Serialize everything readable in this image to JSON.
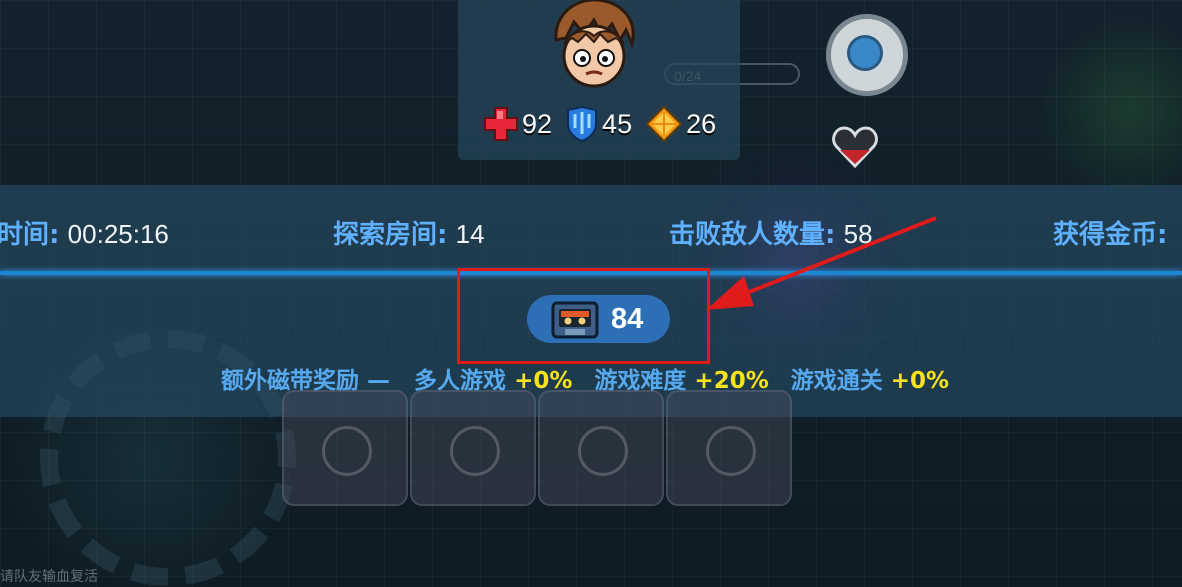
{
  "hud": {
    "health": "92",
    "shield": "45",
    "energy": "26",
    "counter": "0/24"
  },
  "summary": {
    "time_label": "时间:",
    "time_value": "00:25:16",
    "rooms_label": "探索房间:",
    "rooms_value": "14",
    "kills_label": "击败敌人数量:",
    "kills_value": "58",
    "gold_label": "获得金币:"
  },
  "reward": {
    "tape_count": "84"
  },
  "bonus": {
    "title": "额外磁带奖励 —",
    "multiplayer_label": "多人游戏",
    "multiplayer_value": "+0%",
    "difficulty_label": "游戏难度",
    "difficulty_value": "+20%",
    "clear_label": "游戏通关",
    "clear_value": "+0%"
  },
  "hint": {
    "revive_text": "请队友输血复活"
  },
  "colors": {
    "label_blue": "#5fb0ff",
    "bonus_yellow": "#f6e21d",
    "highlight_red": "#e01b1b",
    "tape_pill": "#2d6fb5"
  }
}
